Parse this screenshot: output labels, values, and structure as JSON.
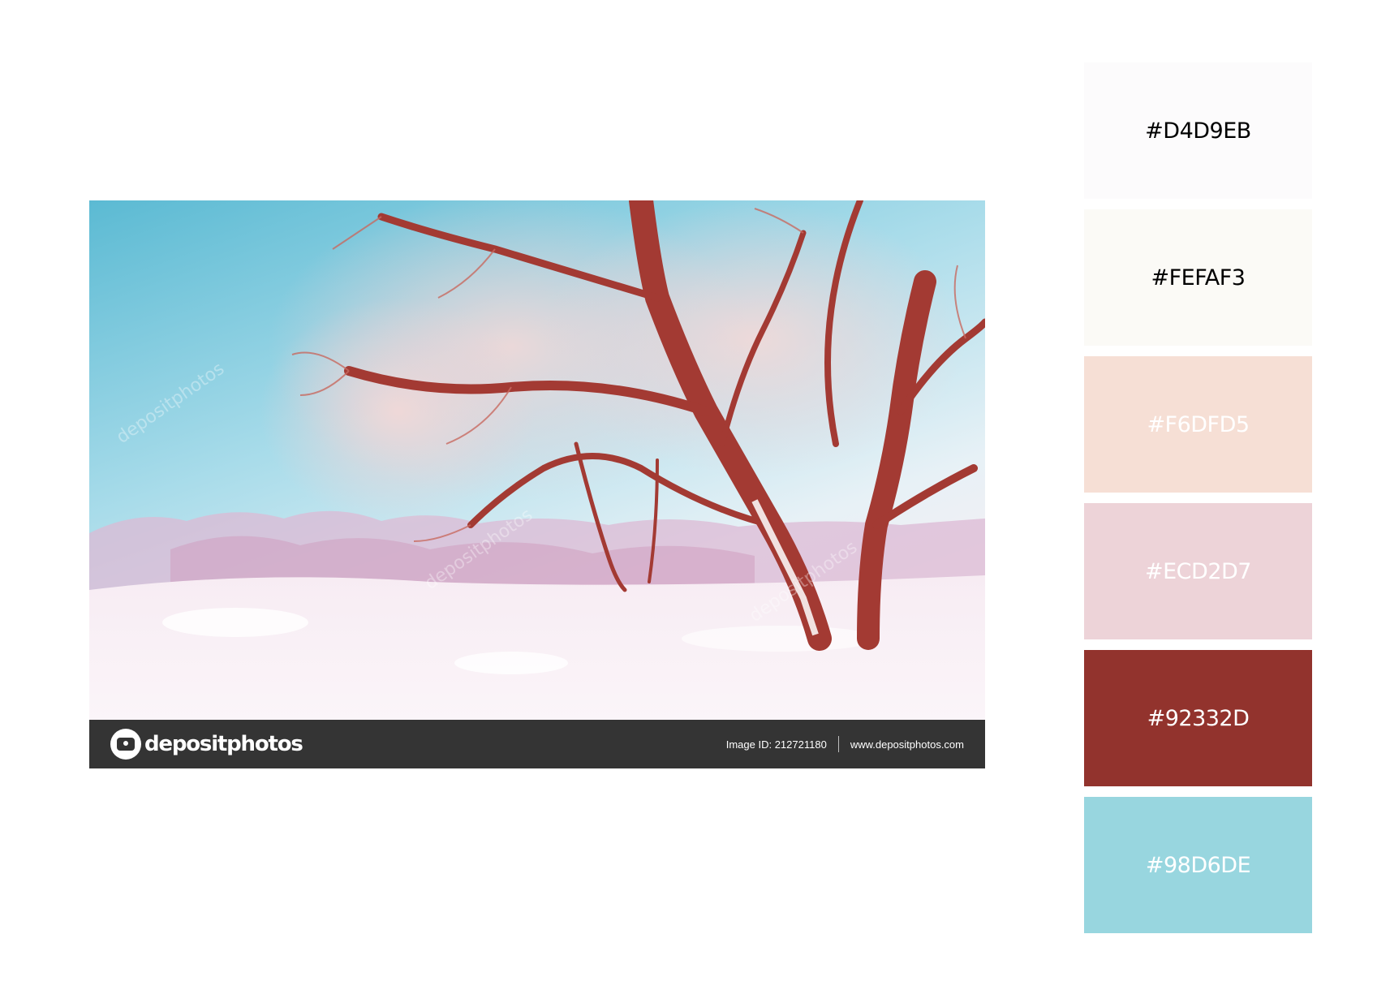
{
  "photo": {
    "caption_brand": "depositphotos",
    "image_id_text": "Image ID: 212721180",
    "site_url": "www.depositphotos.com",
    "watermark": "depositphotos"
  },
  "palette": [
    {
      "hex": "#D4D9EB",
      "color": "#FCFBFC",
      "text_color": "#000000"
    },
    {
      "hex": "#FEFAF3",
      "color": "#FBFAF6",
      "text_color": "#000000"
    },
    {
      "hex": "#F6DFD5",
      "color": "#F6DFD5",
      "text_color": "#FFFFFF"
    },
    {
      "hex": "#ECD2D7",
      "color": "#EDD3D8",
      "text_color": "#FFFFFF"
    },
    {
      "hex": "#92332D",
      "color": "#92332D",
      "text_color": "#FFFFFF"
    },
    {
      "hex": "#98D6DE",
      "color": "#98D6DF",
      "text_color": "#FFFFFF"
    }
  ]
}
